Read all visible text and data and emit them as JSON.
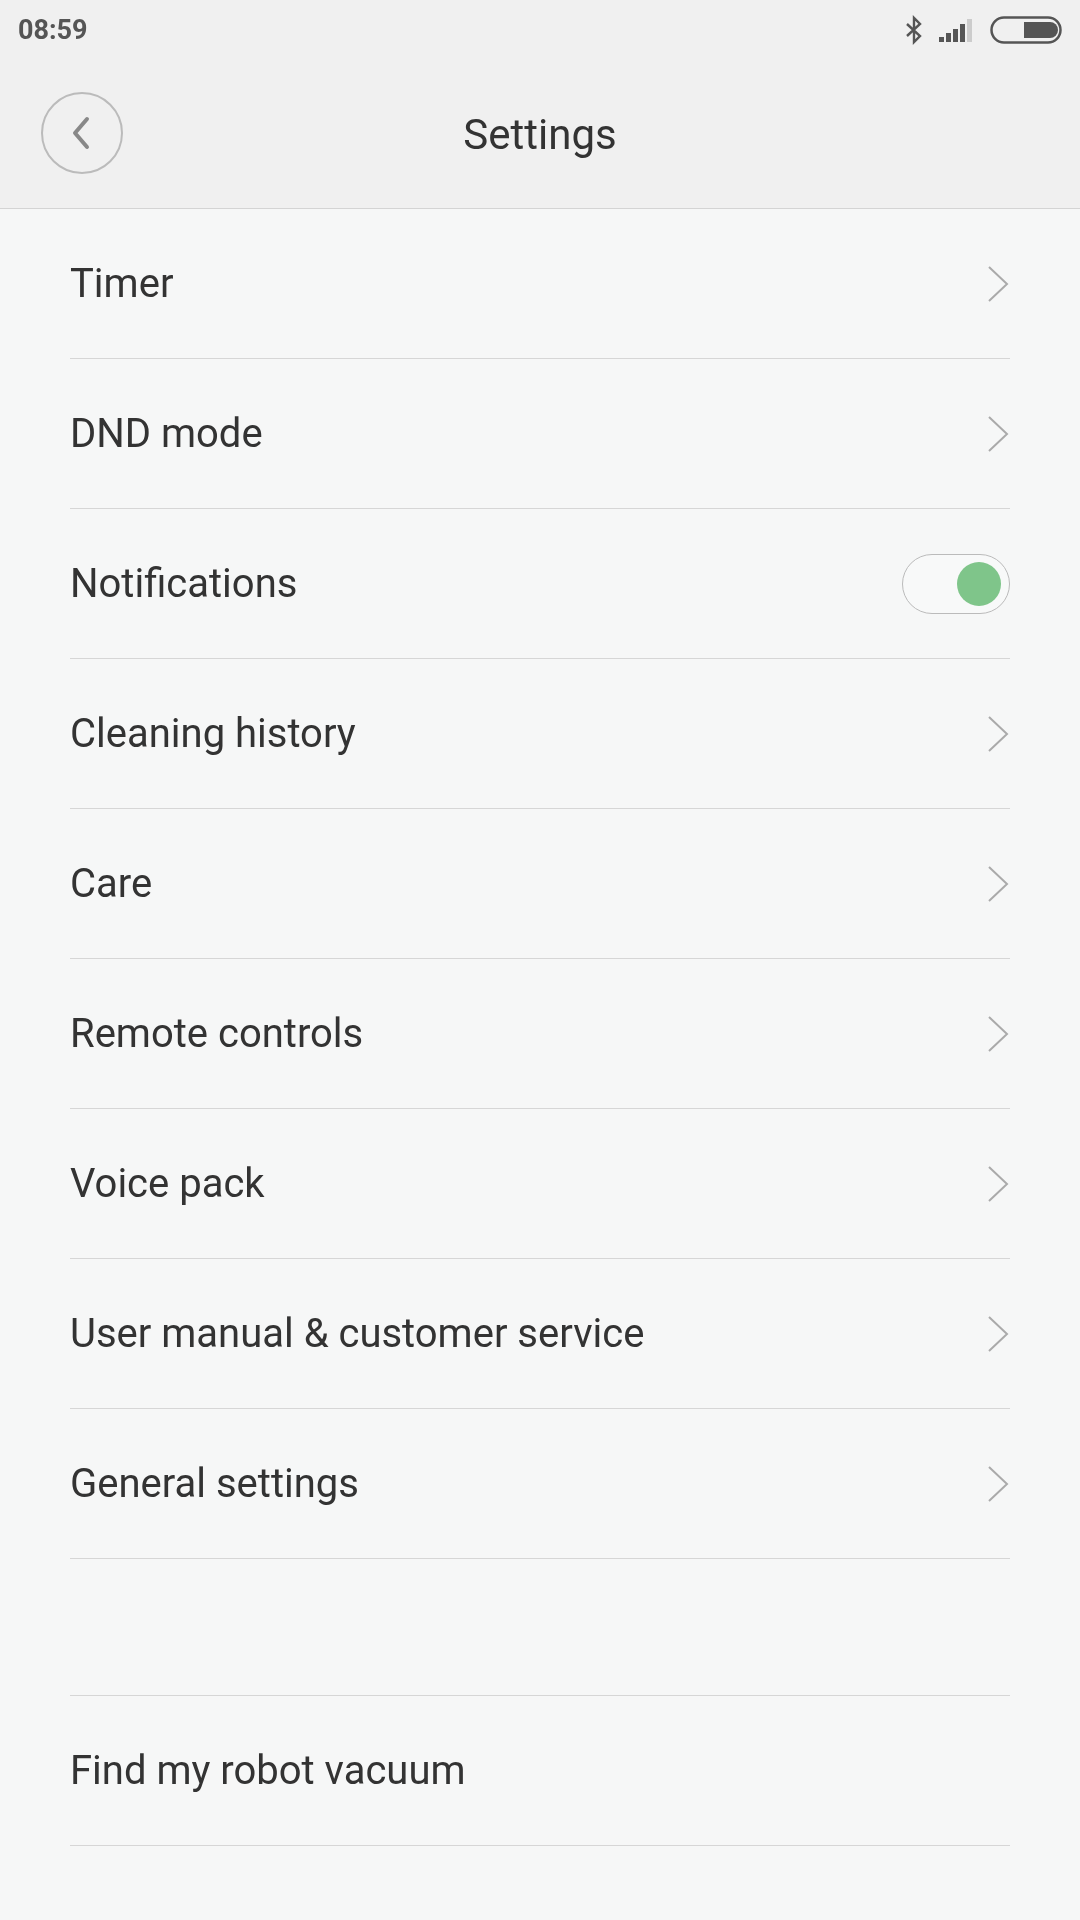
{
  "status_bar": {
    "time": "08:59"
  },
  "header": {
    "title": "Settings"
  },
  "groups": [
    {
      "items": [
        {
          "kind": "link",
          "label": "Timer"
        },
        {
          "kind": "link",
          "label": "DND mode"
        },
        {
          "kind": "toggle",
          "label": "Notifications",
          "on": true
        },
        {
          "kind": "link",
          "label": "Cleaning history"
        },
        {
          "kind": "link",
          "label": "Care"
        },
        {
          "kind": "link",
          "label": "Remote controls"
        },
        {
          "kind": "link",
          "label": "Voice pack"
        },
        {
          "kind": "link",
          "label": "User manual & customer service"
        },
        {
          "kind": "link",
          "label": "General settings"
        }
      ]
    },
    {
      "items": [
        {
          "kind": "plain",
          "label": "Find my robot vacuum"
        }
      ]
    }
  ]
}
